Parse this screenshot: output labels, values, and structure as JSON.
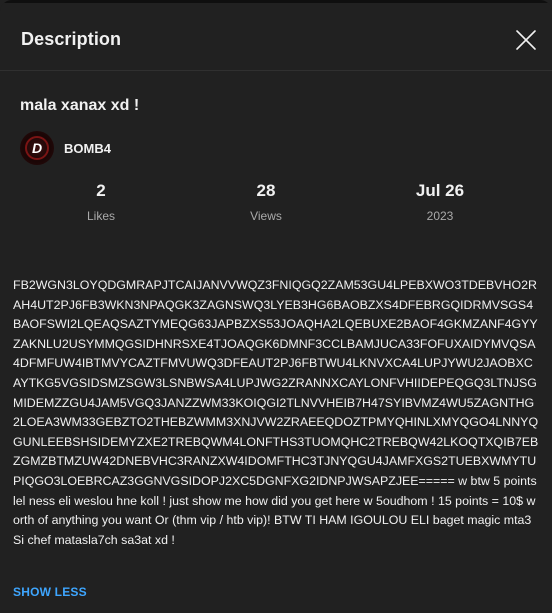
{
  "header": {
    "title": "Description",
    "close_icon": "close-icon"
  },
  "video": {
    "title": "mala xanax xd !"
  },
  "channel": {
    "name": "BOMB4",
    "avatar_letter": "D",
    "avatar_icon": "avatar"
  },
  "stats": {
    "likes": {
      "value": "2",
      "label": "Likes"
    },
    "views": {
      "value": "28",
      "label": "Views"
    },
    "date": {
      "value": "Jul 26",
      "label": "2023"
    }
  },
  "description": {
    "text": "FB2WGN3LOYQDGMRAPJTCAIJANVVWQZ3FNIQGQ2ZAM53GU4LPEBXWO3TDEBVHO2RAH4UT2PJ6FB3WKN3NPAQGK3ZAGNSWQ3LYEB3HG6BAOBZXS4DFEBRGQIDRMVSGS4BAOFSWI2LQEAQSAZTYMEQG63JAPBZXS53JOAQHA2LQEBUXE2BAOF4GKMZANF4GYYZAKNLU2USYMMQGSIDHNRSXE4TJOAQGK6DMNF3CCLBAMJUCA33FOFUXAIDYMVQSA4DFMFUW4IBTMVYCAZTFMVUWQ3DFEAUT2PJ6FBTWU4LKNVXCA4LUPJYWU2JAOBXCAYTKG5VGSIDSMZSGW3LSNBWSA4LUPJWG2ZRANNXCAYLONFVHIIDEPEQGQ3LTNJSGMIDEMZZGU4JAM5VGQ3JANZZWM33KOIQGI2TLNVVHEIB7H47SYIBVMZ4WU5ZAGNTHG2LOEA3WM33GEBZTO2THEBZWMM3XNJVW2ZRAEEQDOZTPMYQHINLXMYQGO4LNNYQGUNLEEBSHSIDEMYZXE2TREBQWM4LONFTHS3TUOMQHC2TREBQW42LKOQTXQIB7EBZGMZBTMZUW42DNEBVHC3RANZXW4IDOMFTHC3TJNYQGU4JAMFXGS2TUEBXWMYTUPIQGO3LOEBRCAZ3GGNVGSIDOPJ2XC5DGNFXG2IDNPJWSAPZJEE===== w btw 5 points lel ness eli weslou hne koll ! just show me how did you get here w 5oudhom ! 15 points = 10$ worth of anything you want Or (thm vip / htb vip)! BTW TI HAM IGOULOU ELI baget magic mta3 Si chef matasla7ch sa3at xd !"
  },
  "actions": {
    "show_less": "SHOW LESS"
  },
  "colors": {
    "background": "#212121",
    "text_primary": "#f1f1f1",
    "text_secondary": "#aaaaaa",
    "link": "#3ea6ff"
  }
}
